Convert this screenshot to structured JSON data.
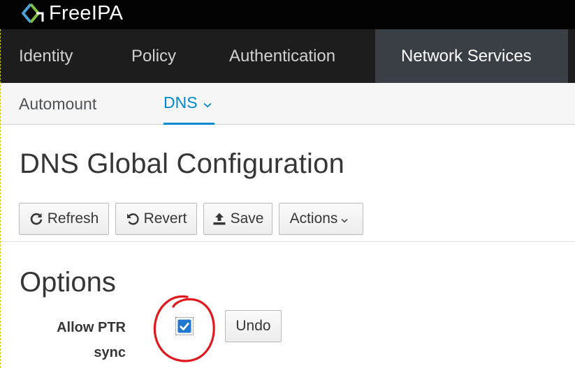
{
  "brand": {
    "name": "FreeIPA"
  },
  "primary_nav": {
    "items": [
      {
        "label": "Identity",
        "active": false
      },
      {
        "label": "Policy",
        "active": false
      },
      {
        "label": "Authentication",
        "active": false
      },
      {
        "label": "Network Services",
        "active": true
      }
    ]
  },
  "secondary_nav": {
    "items": [
      {
        "label": "Automount",
        "active": false
      },
      {
        "label": "DNS",
        "active": true,
        "has_dropdown": true
      }
    ]
  },
  "page": {
    "title": "DNS Global Configuration"
  },
  "toolbar": {
    "refresh_label": "Refresh",
    "revert_label": "Revert",
    "save_label": "Save",
    "actions_label": "Actions"
  },
  "options": {
    "section_title": "Options",
    "fields": [
      {
        "label_line1": "Allow PTR",
        "label_line2": "sync",
        "checked": true,
        "undo_label": "Undo"
      }
    ]
  },
  "colors": {
    "accent": "#0088ce",
    "brand_bar": "#030303",
    "nav_bg": "#1d1d1d",
    "nav_active": "#393f44",
    "annotation": "#e0191e"
  },
  "icons": [
    "freeipa-logo-icon",
    "refresh-icon",
    "revert-icon",
    "upload-icon",
    "chevron-down-icon",
    "checkmark-icon"
  ]
}
